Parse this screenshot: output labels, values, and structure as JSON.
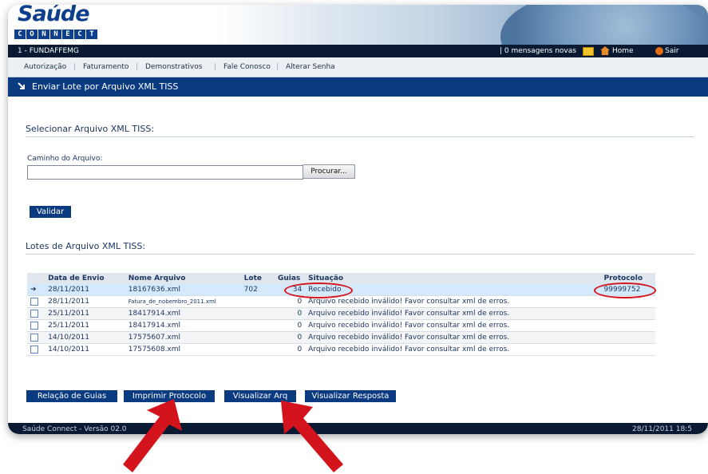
{
  "header": {
    "logo_text": "Saúde",
    "logo_sub": [
      "C",
      "O",
      "N",
      "N",
      "E",
      "C",
      "T"
    ],
    "org": "1 - FUNDAFFEMG",
    "messages": "| 0 mensagens novas",
    "home": "Home",
    "logout": "Sair"
  },
  "menu": [
    "Autorização",
    "Faturamento",
    "Demonstrativos",
    "Fale Conosco",
    "Alterar Senha"
  ],
  "page_title": "Enviar Lote por Arquivo XML TISS",
  "upload": {
    "section_title": "Selecionar Arquivo XML TISS:",
    "path_label": "Caminho do Arquivo:",
    "path_value": "",
    "browse": "Procurar...",
    "validate": "Validar"
  },
  "lots": {
    "section_title": "Lotes de Arquivo XML TISS:",
    "columns": [
      "Data de Envio",
      "Nome Arquivo",
      "Lote",
      "Guias",
      "Situação",
      "Protocolo"
    ],
    "rows": [
      {
        "date": "28/11/2011",
        "file": "18167636.xml",
        "lote": "702",
        "guias": "34",
        "status": "Recebido",
        "protocolo": "99999752"
      },
      {
        "date": "28/11/2011",
        "file": "Fatura_de_nobembro_2011.xml",
        "lote": "",
        "guias": "0",
        "status": "Arquivo recebido inválido! Favor consultar xml de erros.",
        "protocolo": ""
      },
      {
        "date": "25/11/2011",
        "file": "18417914.xml",
        "lote": "",
        "guias": "0",
        "status": "Arquivo recebido inválido! Favor consultar xml de erros.",
        "protocolo": ""
      },
      {
        "date": "25/11/2011",
        "file": "18417914.xml",
        "lote": "",
        "guias": "0",
        "status": "Arquivo recebido inválido! Favor consultar xml de erros.",
        "protocolo": ""
      },
      {
        "date": "14/10/2011",
        "file": "17575607.xml",
        "lote": "",
        "guias": "0",
        "status": "Arquivo recebido inválido! Favor consultar xml de erros.",
        "protocolo": ""
      },
      {
        "date": "14/10/2011",
        "file": "17575608.xml",
        "lote": "",
        "guias": "0",
        "status": "Arquivo recebido inválido! Favor consultar xml de erros.",
        "protocolo": ""
      }
    ]
  },
  "actions": [
    "Relação de Guias",
    "Imprimir Protocolo",
    "Visualizar Arq",
    "Visualizar Resposta"
  ],
  "footer": {
    "version": "Saúde Connect - Versão 02.0",
    "datetime": "28/11/2011 18:5"
  },
  "colors": {
    "primary": "#0a3a80",
    "topbar": "#0a1a33",
    "highlight": "#d4141c",
    "selected_row": "#d4eafc"
  }
}
